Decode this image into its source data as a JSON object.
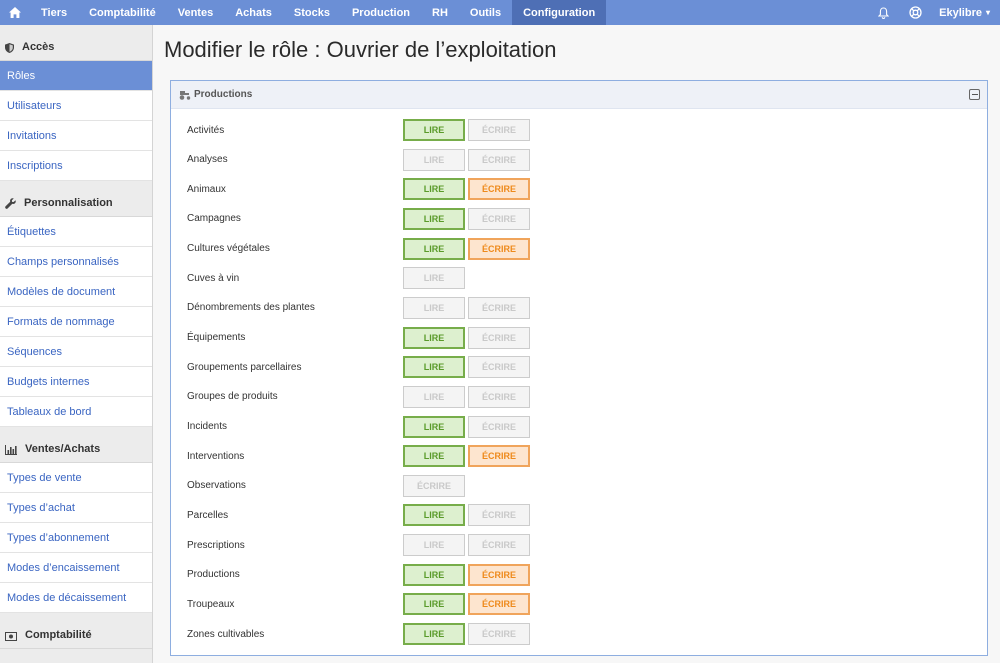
{
  "nav": {
    "items": [
      "Tiers",
      "Comptabilité",
      "Ventes",
      "Achats",
      "Stocks",
      "Production",
      "RH",
      "Outils",
      "Configuration"
    ],
    "active": "Configuration",
    "user": "Ekylibre"
  },
  "sidebar": {
    "sections": [
      {
        "title": "Accès",
        "icon": "shield-icon",
        "items": [
          {
            "label": "Rôles",
            "active": true
          },
          {
            "label": "Utilisateurs"
          },
          {
            "label": "Invitations"
          },
          {
            "label": "Inscriptions"
          }
        ]
      },
      {
        "title": "Personnalisation",
        "icon": "wrench-icon",
        "items": [
          {
            "label": "Étiquettes"
          },
          {
            "label": "Champs personnalisés"
          },
          {
            "label": "Modèles de document"
          },
          {
            "label": "Formats de nommage"
          },
          {
            "label": "Séquences"
          },
          {
            "label": "Budgets internes"
          },
          {
            "label": "Tableaux de bord"
          }
        ]
      },
      {
        "title": "Ventes/Achats",
        "icon": "bar-chart-icon",
        "items": [
          {
            "label": "Types de vente"
          },
          {
            "label": "Types d’achat"
          },
          {
            "label": "Types d’abonnement"
          },
          {
            "label": "Modes d’encaissement"
          },
          {
            "label": "Modes de décaissement"
          }
        ]
      },
      {
        "title": "Comptabilité",
        "icon": "money-icon",
        "items": []
      }
    ]
  },
  "page": {
    "title": "Modifier le rôle : Ouvrier de l’exploitation"
  },
  "panel": {
    "title": "Productions",
    "rows": [
      {
        "label": "Activités",
        "buttons": [
          {
            "text": "LIRE",
            "kind": "lire",
            "on": true
          },
          {
            "text": "ÉCRIRE",
            "kind": "ecrire",
            "on": false
          }
        ]
      },
      {
        "label": "Analyses",
        "buttons": [
          {
            "text": "LIRE",
            "kind": "lire",
            "on": false
          },
          {
            "text": "ÉCRIRE",
            "kind": "ecrire",
            "on": false
          }
        ]
      },
      {
        "label": "Animaux",
        "buttons": [
          {
            "text": "LIRE",
            "kind": "lire",
            "on": true
          },
          {
            "text": "ÉCRIRE",
            "kind": "ecrire",
            "on": true
          }
        ]
      },
      {
        "label": "Campagnes",
        "buttons": [
          {
            "text": "LIRE",
            "kind": "lire",
            "on": true
          },
          {
            "text": "ÉCRIRE",
            "kind": "ecrire",
            "on": false
          }
        ]
      },
      {
        "label": "Cultures végétales",
        "buttons": [
          {
            "text": "LIRE",
            "kind": "lire",
            "on": true
          },
          {
            "text": "ÉCRIRE",
            "kind": "ecrire",
            "on": true
          }
        ]
      },
      {
        "label": "Cuves à vin",
        "buttons": [
          {
            "text": "LIRE",
            "kind": "lire",
            "on": false
          }
        ]
      },
      {
        "label": "Dénombrements des plantes",
        "buttons": [
          {
            "text": "LIRE",
            "kind": "lire",
            "on": false
          },
          {
            "text": "ÉCRIRE",
            "kind": "ecrire",
            "on": false
          }
        ]
      },
      {
        "label": "Équipements",
        "buttons": [
          {
            "text": "LIRE",
            "kind": "lire",
            "on": true
          },
          {
            "text": "ÉCRIRE",
            "kind": "ecrire",
            "on": false
          }
        ]
      },
      {
        "label": "Groupements parcellaires",
        "buttons": [
          {
            "text": "LIRE",
            "kind": "lire",
            "on": true
          },
          {
            "text": "ÉCRIRE",
            "kind": "ecrire",
            "on": false
          }
        ]
      },
      {
        "label": "Groupes de produits",
        "buttons": [
          {
            "text": "LIRE",
            "kind": "lire",
            "on": false
          },
          {
            "text": "ÉCRIRE",
            "kind": "ecrire",
            "on": false
          }
        ]
      },
      {
        "label": "Incidents",
        "buttons": [
          {
            "text": "LIRE",
            "kind": "lire",
            "on": true
          },
          {
            "text": "ÉCRIRE",
            "kind": "ecrire",
            "on": false
          }
        ]
      },
      {
        "label": "Interventions",
        "buttons": [
          {
            "text": "LIRE",
            "kind": "lire",
            "on": true
          },
          {
            "text": "ÉCRIRE",
            "kind": "ecrire",
            "on": true
          }
        ]
      },
      {
        "label": "Observations",
        "buttons": [
          {
            "text": "ÉCRIRE",
            "kind": "ecrire",
            "on": false
          }
        ]
      },
      {
        "label": "Parcelles",
        "buttons": [
          {
            "text": "LIRE",
            "kind": "lire",
            "on": true
          },
          {
            "text": "ÉCRIRE",
            "kind": "ecrire",
            "on": false
          }
        ]
      },
      {
        "label": "Prescriptions",
        "buttons": [
          {
            "text": "LIRE",
            "kind": "lire",
            "on": false
          },
          {
            "text": "ÉCRIRE",
            "kind": "ecrire",
            "on": false
          }
        ]
      },
      {
        "label": "Productions",
        "buttons": [
          {
            "text": "LIRE",
            "kind": "lire",
            "on": true
          },
          {
            "text": "ÉCRIRE",
            "kind": "ecrire",
            "on": true
          }
        ]
      },
      {
        "label": "Troupeaux",
        "buttons": [
          {
            "text": "LIRE",
            "kind": "lire",
            "on": true
          },
          {
            "text": "ÉCRIRE",
            "kind": "ecrire",
            "on": true
          }
        ]
      },
      {
        "label": "Zones cultivables",
        "buttons": [
          {
            "text": "LIRE",
            "kind": "lire",
            "on": true
          },
          {
            "text": "ÉCRIRE",
            "kind": "ecrire",
            "on": false
          }
        ]
      }
    ]
  },
  "colors": {
    "nav": "#6b8fd6",
    "nav_active": "#4e6fb5",
    "lire_on": "#77ad4a",
    "ecrire_on": "#f0a45b",
    "link": "#3a65c2"
  }
}
